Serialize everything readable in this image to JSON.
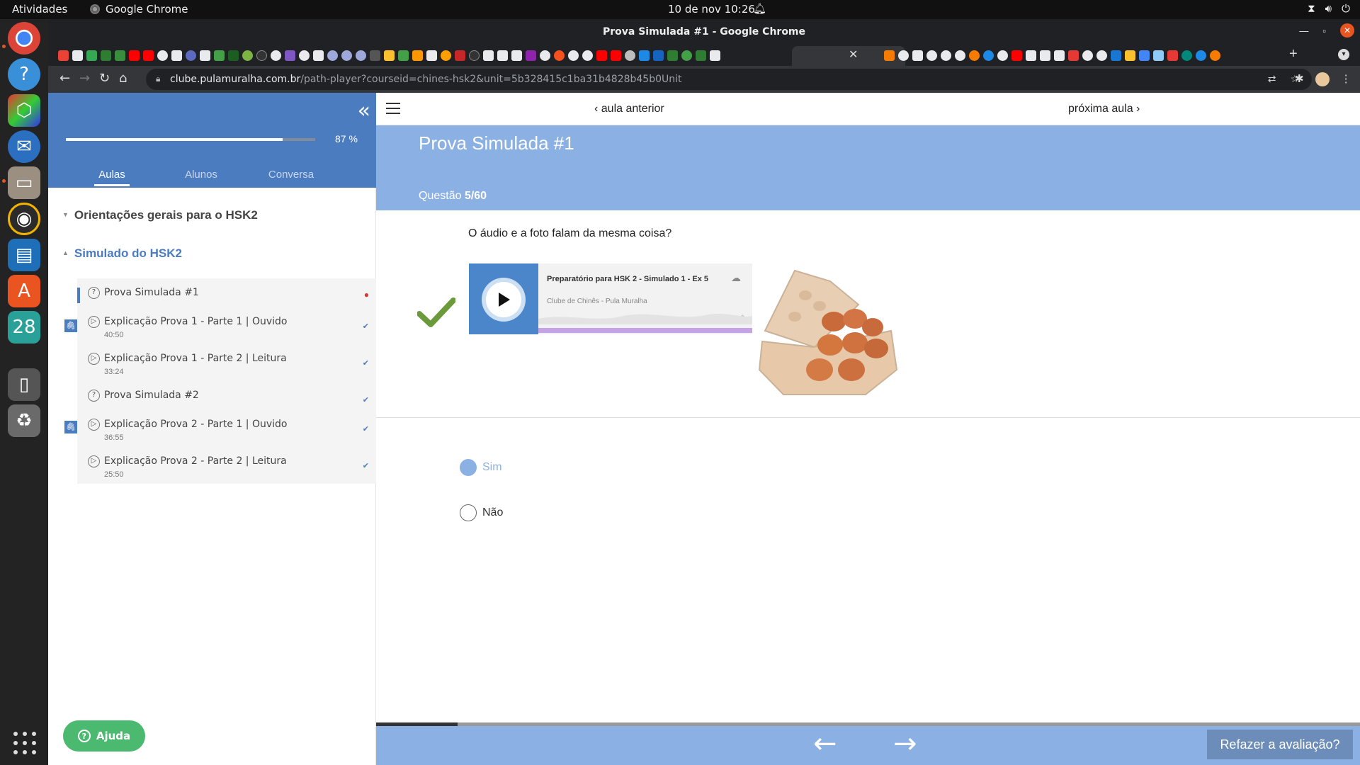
{
  "os": {
    "activities": "Atividades",
    "app_name": "Google Chrome",
    "clock": "10 de nov  10:26"
  },
  "browser": {
    "window_title": "Prova Simulada #1 - Google Chrome",
    "url_host": "clube.pulamuralha.com.br",
    "url_path": "/path-player?courseid=chines-hsk2&unit=5b328415c1ba31b4828b45b0Unit"
  },
  "sidebar": {
    "progress_percent": 87,
    "progress_label": "87 %",
    "tabs": [
      {
        "label": "Aulas",
        "active": true
      },
      {
        "label": "Alunos",
        "active": false
      },
      {
        "label": "Conversa",
        "active": false
      }
    ],
    "sections": [
      {
        "title": "Orientações gerais para o HSK2"
      },
      {
        "title": "Simulado do HSK2"
      }
    ],
    "lessons": [
      {
        "name": "Prova Simulada #1",
        "duration": "",
        "status": "current",
        "icon": "question-icon",
        "attachment": false
      },
      {
        "name": "Explicação Prova 1 - Parte 1 | Ouvido",
        "duration": "40:50",
        "status": "done",
        "icon": "play-icon",
        "attachment": true
      },
      {
        "name": "Explicação Prova 1 - Parte 2 | Leitura",
        "duration": "33:24",
        "status": "done",
        "icon": "play-icon",
        "attachment": false
      },
      {
        "name": "Prova Simulada #2",
        "duration": "",
        "status": "done",
        "icon": "question-icon",
        "attachment": false
      },
      {
        "name": "Explicação Prova 2 - Parte 1 | Ouvido",
        "duration": "36:55",
        "status": "done",
        "icon": "play-icon",
        "attachment": true
      },
      {
        "name": "Explicação Prova 2 - Parte 2 | Leitura",
        "duration": "25:50",
        "status": "done",
        "icon": "play-icon",
        "attachment": false
      }
    ],
    "help_label": "Ajuda"
  },
  "main": {
    "prev_label": "aula anterior",
    "next_label": "próxima aula",
    "page_title": "Prova Simulada #1",
    "question_label": "Questão",
    "question_number": "5/60",
    "question_text": "O áudio e a foto falam da mesma coisa?",
    "player": {
      "title": "Preparatório para HSK 2 - Simulado 1 - Ex 5",
      "artist": "Clube de Chinês - Pula Muralha"
    },
    "options": [
      {
        "label": "Sim",
        "selected": true
      },
      {
        "label": "Não",
        "selected": false
      }
    ],
    "bottom_progress_fraction": 0.083,
    "retry_label": "Refazer a avaliação?"
  },
  "colors": {
    "accent": "#4a7cbf",
    "header_light": "#8bb0e3",
    "success_check": "#6a9a3a",
    "help_green": "#4bb96f"
  }
}
